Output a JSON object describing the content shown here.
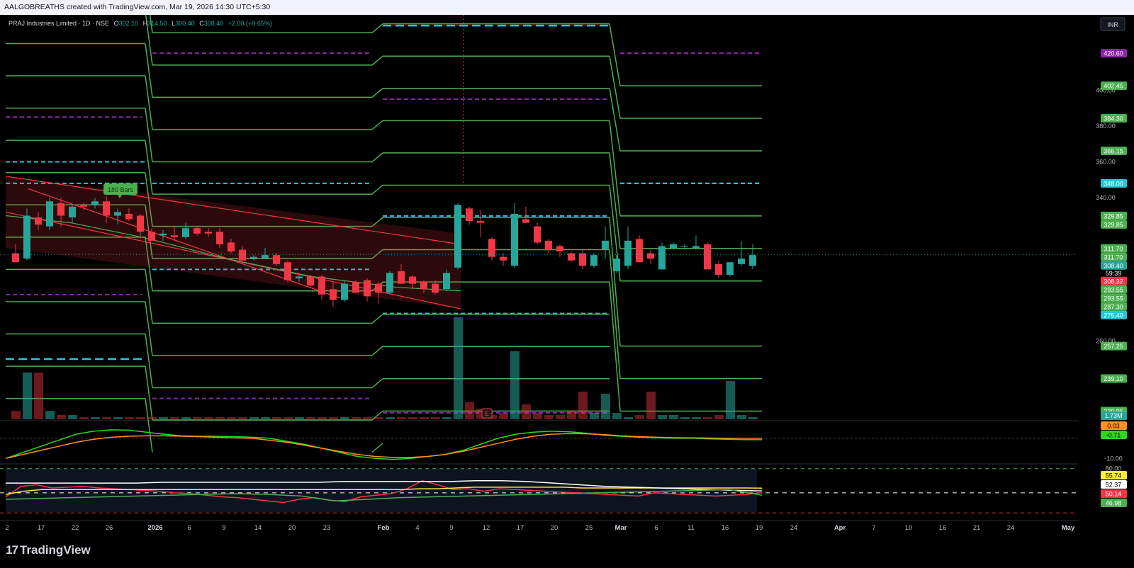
{
  "header": {
    "attribution": "AALGOBREATHS created with TradingView.com, Mar 19, 2026 14:30 UTC+5:30",
    "symbol": "PRAJ Industries Limited · 1D · NSE",
    "o_label": "O",
    "o_value": "302.10",
    "h_label": "H",
    "h_value": "314.50",
    "l_label": "L",
    "l_value": "300.40",
    "c_label": "C",
    "c_value": "308.40",
    "change": "+2.00 (+0.65%)"
  },
  "currency": "INR",
  "brand": "TradingView",
  "colors": {
    "background": "#000000",
    "up": "#26a69a",
    "down": "#f23645",
    "level_green": "#4caf50",
    "dashed_cyan": "#26c6da",
    "dashed_purple": "#8e24aa",
    "macd_fast": "#2bd91c",
    "macd_slow": "#ff8f1f",
    "rsi": "#f23645",
    "rsi_ma": "#ffeb3b"
  },
  "annotations": {
    "bars_badge": "180 Bars",
    "earnings_marker": "E"
  },
  "chart_data": [
    {
      "type": "candlestick",
      "title": "PRAJ Industries Limited · 1D · NSE",
      "ylim": [
        216,
        442
      ],
      "x_tick_labels": [
        "2",
        "17",
        "22",
        "26",
        "2026",
        "6",
        "9",
        "14",
        "20",
        "23",
        "Feb",
        "4",
        "9",
        "12",
        "17",
        "20",
        "25",
        "Mar",
        "6",
        "11",
        "16",
        "19",
        "24",
        "Apr",
        "7",
        "10",
        "16",
        "21",
        "24",
        "May"
      ],
      "price_scale_ticks": [
        "400.00",
        "380.00",
        "360.00",
        "340.00",
        "260.00"
      ],
      "candles": [
        {
          "o": 309,
          "h": 314,
          "l": 304,
          "c": 304
        },
        {
          "o": 306,
          "h": 334,
          "l": 305,
          "c": 330
        },
        {
          "o": 329,
          "h": 332,
          "l": 322,
          "c": 325
        },
        {
          "o": 324,
          "h": 340,
          "l": 322,
          "c": 338
        },
        {
          "o": 337,
          "h": 340,
          "l": 324,
          "c": 330
        },
        {
          "o": 329,
          "h": 336,
          "l": 326,
          "c": 335
        },
        {
          "o": 336,
          "h": 337,
          "l": 333,
          "c": 335
        },
        {
          "o": 336,
          "h": 340,
          "l": 334,
          "c": 338
        },
        {
          "o": 338,
          "h": 341,
          "l": 326,
          "c": 330
        },
        {
          "o": 330,
          "h": 334,
          "l": 325,
          "c": 332
        },
        {
          "o": 331,
          "h": 334,
          "l": 327,
          "c": 328
        },
        {
          "o": 330,
          "h": 331,
          "l": 317,
          "c": 321
        },
        {
          "o": 321,
          "h": 323,
          "l": 316,
          "c": 316
        },
        {
          "o": 319,
          "h": 322,
          "l": 316,
          "c": 320
        },
        {
          "o": 319,
          "h": 324,
          "l": 316,
          "c": 318
        },
        {
          "o": 318,
          "h": 326,
          "l": 317,
          "c": 323
        },
        {
          "o": 323,
          "h": 324,
          "l": 319,
          "c": 320
        },
        {
          "o": 321,
          "h": 323,
          "l": 318,
          "c": 320
        },
        {
          "o": 321,
          "h": 323,
          "l": 312,
          "c": 314
        },
        {
          "o": 315,
          "h": 317,
          "l": 309,
          "c": 310
        },
        {
          "o": 311,
          "h": 313,
          "l": 303,
          "c": 305
        },
        {
          "o": 306,
          "h": 308,
          "l": 305,
          "c": 307
        },
        {
          "o": 306,
          "h": 312,
          "l": 306,
          "c": 308
        },
        {
          "o": 308,
          "h": 309,
          "l": 302,
          "c": 303
        },
        {
          "o": 304,
          "h": 305,
          "l": 293,
          "c": 294
        },
        {
          "o": 295,
          "h": 297,
          "l": 293,
          "c": 296
        },
        {
          "o": 296,
          "h": 297,
          "l": 290,
          "c": 291
        },
        {
          "o": 296,
          "h": 297,
          "l": 283,
          "c": 286
        },
        {
          "o": 289,
          "h": 293,
          "l": 279,
          "c": 283
        },
        {
          "o": 283,
          "h": 294,
          "l": 282,
          "c": 292
        },
        {
          "o": 293,
          "h": 294,
          "l": 287,
          "c": 287
        },
        {
          "o": 294,
          "h": 295,
          "l": 282,
          "c": 285
        },
        {
          "o": 292,
          "h": 293,
          "l": 281,
          "c": 287
        },
        {
          "o": 287,
          "h": 299,
          "l": 286,
          "c": 298
        },
        {
          "o": 299,
          "h": 303,
          "l": 292,
          "c": 292
        },
        {
          "o": 296,
          "h": 297,
          "l": 289,
          "c": 292
        },
        {
          "o": 293,
          "h": 294,
          "l": 287,
          "c": 289
        },
        {
          "o": 292,
          "h": 294,
          "l": 286,
          "c": 287
        },
        {
          "o": 289,
          "h": 300,
          "l": 288,
          "c": 298
        },
        {
          "o": 301,
          "h": 337,
          "l": 300,
          "c": 336
        },
        {
          "o": 334,
          "h": 335,
          "l": 325,
          "c": 327
        },
        {
          "o": 327,
          "h": 333,
          "l": 318,
          "c": 326
        },
        {
          "o": 317,
          "h": 318,
          "l": 305,
          "c": 307
        },
        {
          "o": 307,
          "h": 309,
          "l": 302,
          "c": 305
        },
        {
          "o": 302,
          "h": 337,
          "l": 301,
          "c": 331
        },
        {
          "o": 328,
          "h": 335,
          "l": 326,
          "c": 326
        },
        {
          "o": 324,
          "h": 326,
          "l": 314,
          "c": 315
        },
        {
          "o": 316,
          "h": 317,
          "l": 309,
          "c": 311
        },
        {
          "o": 313,
          "h": 314,
          "l": 307,
          "c": 310
        },
        {
          "o": 309,
          "h": 310,
          "l": 304,
          "c": 305
        },
        {
          "o": 309,
          "h": 311,
          "l": 300,
          "c": 302
        },
        {
          "o": 302,
          "h": 309,
          "l": 301,
          "c": 308
        },
        {
          "o": 311,
          "h": 324,
          "l": 306,
          "c": 316
        },
        {
          "o": 299,
          "h": 308,
          "l": 298,
          "c": 306
        },
        {
          "o": 302,
          "h": 324,
          "l": 300,
          "c": 316
        },
        {
          "o": 317,
          "h": 319,
          "l": 306,
          "c": 304
        },
        {
          "o": 309,
          "h": 311,
          "l": 303,
          "c": 306
        },
        {
          "o": 300,
          "h": 315,
          "l": 300,
          "c": 313
        },
        {
          "o": 312,
          "h": 315,
          "l": 311,
          "c": 314
        },
        {
          "o": 313,
          "h": 314,
          "l": 311,
          "c": 313
        },
        {
          "o": 312,
          "h": 319,
          "l": 311,
          "c": 313
        },
        {
          "o": 314,
          "h": 315,
          "l": 306,
          "c": 300
        },
        {
          "o": 303,
          "h": 305,
          "l": 295,
          "c": 297
        },
        {
          "o": 297,
          "h": 303,
          "l": 296,
          "c": 304
        },
        {
          "o": 303,
          "h": 316,
          "l": 302,
          "c": 306
        },
        {
          "o": 302,
          "h": 314,
          "l": 300,
          "c": 308
        }
      ],
      "volume": [
        0.4,
        2.2,
        2.2,
        0.4,
        0.2,
        0.2,
        0.1,
        0.1,
        0.1,
        0.1,
        0.1,
        0.1,
        0.1,
        0.1,
        0.1,
        0.1,
        0.1,
        0.1,
        0.1,
        0.1,
        0.1,
        0.1,
        0.1,
        0.1,
        0.1,
        0.1,
        0.1,
        0.1,
        0.1,
        0.1,
        0.1,
        0.1,
        0.1,
        0.1,
        0.1,
        0.1,
        0.1,
        0.1,
        0.1,
        4.8,
        0.8,
        0.5,
        0.2,
        0.3,
        3.2,
        0.7,
        0.3,
        0.2,
        0.2,
        0.4,
        1.3,
        0.3,
        1.2,
        0.3,
        0.1,
        0.2,
        1.3,
        0.2,
        0.2,
        0.1,
        0.1,
        0.1,
        0.2,
        1.8,
        0.2,
        0.1
      ],
      "level_labels": [
        {
          "value": 420.6,
          "label": "420.60",
          "color": "#8e24aa"
        },
        {
          "value": 402.45,
          "label": "402.45",
          "color": "#4caf50"
        },
        {
          "value": 384.3,
          "label": "384.30",
          "color": "#4caf50"
        },
        {
          "value": 366.15,
          "label": "366.15",
          "color": "#4caf50"
        },
        {
          "value": 348.0,
          "label": "348.00",
          "color": "#26c6da"
        },
        {
          "value": 329.85,
          "label": "329.85",
          "color": "#4caf50"
        },
        {
          "value": 329.85,
          "label": "329.85",
          "color": "#4caf50"
        },
        {
          "value": 311.7,
          "label": "311.70",
          "color": "#4caf50"
        },
        {
          "value": 311.7,
          "label": "311.70",
          "color": "#4caf50"
        },
        {
          "value": 308.4,
          "label": "308.40",
          "sub": "59:39",
          "color": "#26a69a"
        },
        {
          "value": 308.32,
          "label": "308.32",
          "color": "#f23645"
        },
        {
          "value": 293.55,
          "label": "293.55",
          "color": "#4caf50"
        },
        {
          "value": 293.55,
          "label": "293.55",
          "color": "#4caf50"
        },
        {
          "value": 287.3,
          "label": "287.30",
          "color": "#4caf50"
        },
        {
          "value": 275.4,
          "label": "275.40",
          "color": "#26c6da"
        },
        {
          "value": 257.25,
          "label": "257.25",
          "color": "#4caf50"
        },
        {
          "value": 239.1,
          "label": "239.10",
          "color": "#4caf50"
        },
        {
          "value": 220.95,
          "label": "220.95",
          "color": "#4caf50"
        }
      ],
      "volume_label": "1.73M"
    },
    {
      "type": "line",
      "ylim": [
        -12,
        8
      ],
      "y_tick_labels": [
        "-10.00"
      ],
      "value_labels": [
        {
          "label": "0.03",
          "color": "#ff8f1f"
        },
        {
          "label": "-0.71",
          "color": "#2bd91c"
        }
      ],
      "series": [
        {
          "color": "#2bd91c",
          "values": [
            -10,
            -7,
            -4,
            -1,
            2,
            3.5,
            4.2,
            4,
            3,
            2,
            1.2,
            1,
            1,
            0.8,
            0.5,
            0,
            -1.5,
            -3,
            -5,
            -7,
            -9,
            -10,
            -10.5,
            -10,
            -9,
            -8,
            -6,
            -3,
            0,
            2,
            3,
            3.5,
            3.2,
            2.5,
            1.5,
            1,
            0.5,
            0.3,
            0,
            0,
            -0.3,
            -0.5,
            -0.7,
            -0.71
          ]
        },
        {
          "color": "#ff8f1f",
          "values": [
            -10,
            -8,
            -6,
            -4,
            -2,
            -0.5,
            0.5,
            1,
            1.2,
            1.2,
            1,
            0.8,
            0.5,
            0.2,
            0,
            -1,
            -2,
            -3.5,
            -5,
            -6.5,
            -8,
            -9,
            -9.5,
            -9.5,
            -9,
            -8,
            -6.5,
            -4.5,
            -2.5,
            -0.5,
            1,
            2,
            2.3,
            2.2,
            1.8,
            1.2,
            0.8,
            0.5,
            0.3,
            0.2,
            0.1,
            0,
            0.03,
            0.03
          ]
        }
      ]
    },
    {
      "type": "line",
      "ylim": [
        20,
        85
      ],
      "y_tick_labels": [
        "80.00"
      ],
      "value_labels": [
        {
          "label": "55.74",
          "color": "#ffeb3b"
        },
        {
          "label": "52.37",
          "color": "#ffffff"
        },
        {
          "label": "50.14",
          "color": "#f23645"
        },
        {
          "label": "46.98",
          "color": "#4caf50"
        }
      ],
      "series": [
        {
          "color": "#f23645",
          "values": [
            45,
            58,
            60,
            56,
            57,
            58,
            56,
            55,
            54,
            53,
            52,
            50,
            49,
            47,
            45,
            44,
            42,
            40,
            38,
            42,
            44,
            41,
            39,
            45,
            47,
            49,
            55,
            65,
            60,
            54,
            55,
            52,
            55,
            54,
            53,
            52,
            51,
            50,
            49,
            48,
            47,
            46,
            50,
            49,
            48,
            47,
            46,
            47,
            48,
            50.14
          ]
        },
        {
          "color": "#ffeb3b",
          "values": [
            48,
            52,
            54,
            54,
            54,
            54,
            54,
            54,
            54,
            54,
            54,
            54,
            54,
            54,
            54,
            54,
            54,
            54,
            54,
            54,
            54,
            54,
            54,
            55,
            55,
            56,
            57,
            57,
            57,
            57,
            57,
            57,
            56,
            56,
            56,
            56,
            56,
            56,
            56,
            56,
            56,
            56,
            55.74
          ]
        },
        {
          "color": "#ffffff",
          "values": [
            62,
            62,
            62,
            62,
            62,
            62,
            63,
            63,
            63,
            63,
            63,
            63,
            63,
            64,
            64,
            64,
            64,
            64,
            65,
            65,
            64,
            62,
            60,
            58,
            57,
            56,
            55,
            54,
            53,
            52.37
          ]
        },
        {
          "color": "#4caf50",
          "values": [
            42,
            43,
            44,
            45,
            46,
            47,
            48,
            49,
            48,
            46,
            40,
            42,
            44,
            45,
            46,
            47,
            48,
            49,
            50,
            51,
            52,
            53,
            54,
            46.98
          ]
        }
      ]
    }
  ]
}
